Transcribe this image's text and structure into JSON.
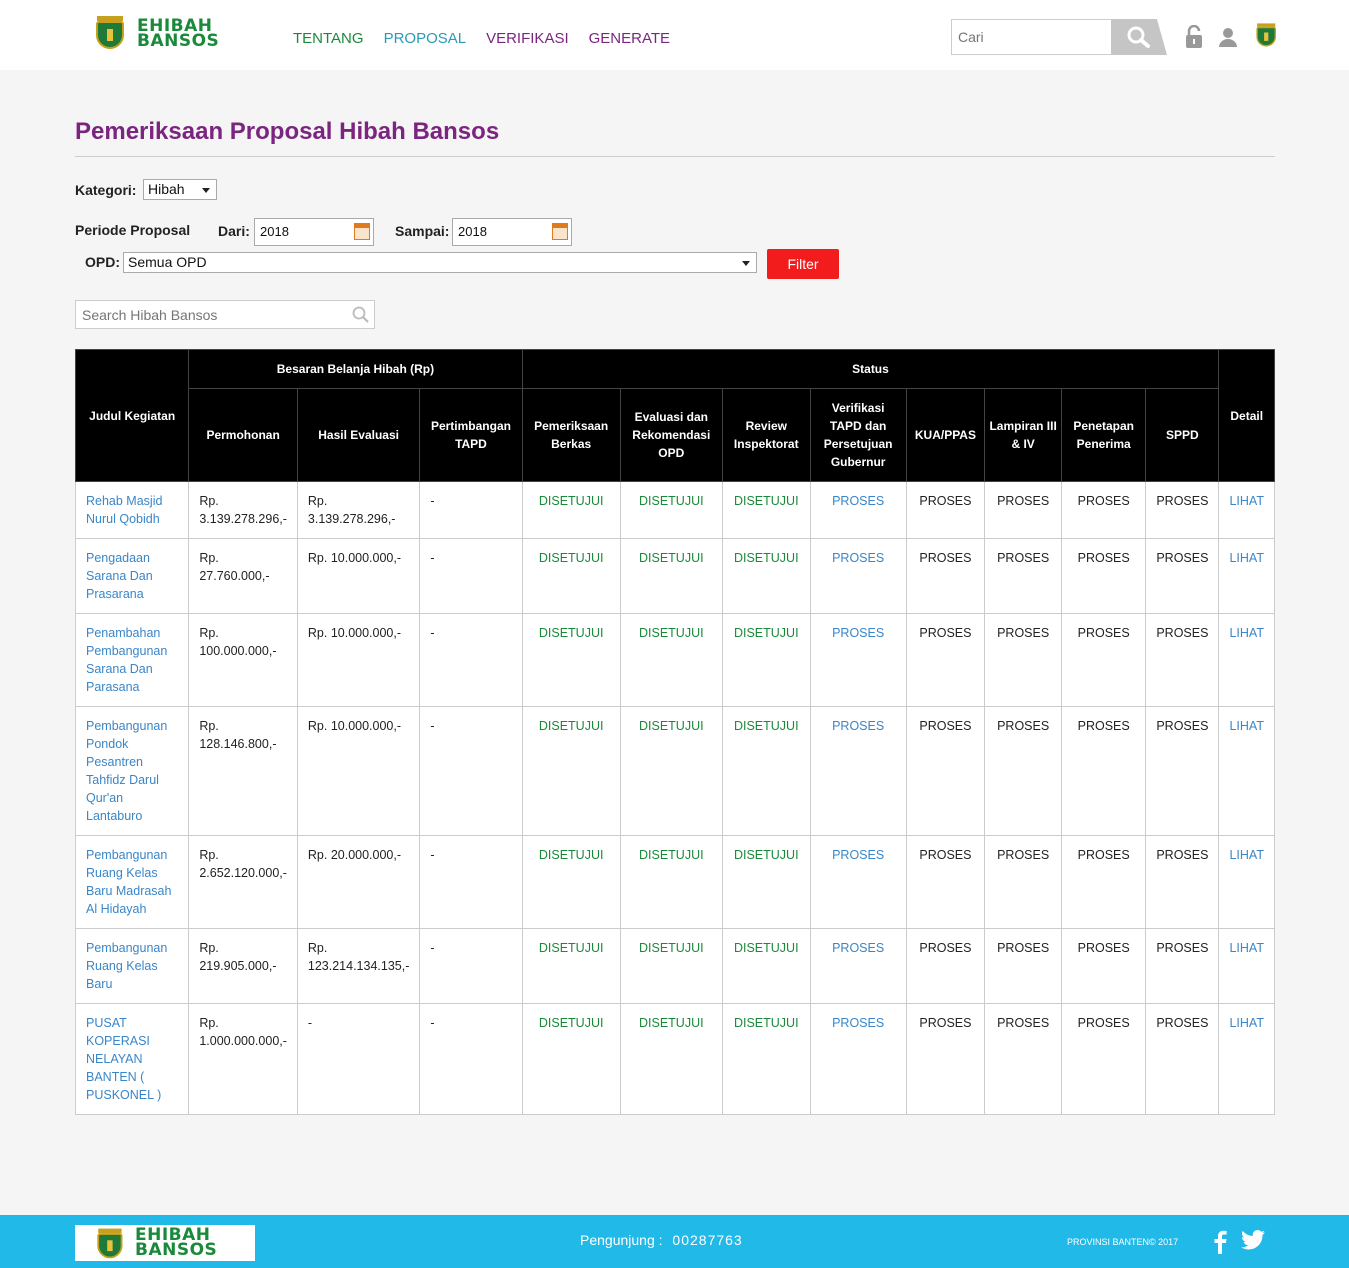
{
  "brand": {
    "line1": "EHIBAH",
    "line2": "BANSOS"
  },
  "nav": [
    "TENTANG",
    "PROPOSAL",
    "VERIFIKASI",
    "GENERATE"
  ],
  "search": {
    "placeholder": "Cari"
  },
  "page": {
    "title": "Pemeriksaan Proposal Hibah Bansos"
  },
  "filters": {
    "kategori_label": "Kategori:",
    "kategori_value": "Hibah",
    "periode_label": "Periode Proposal",
    "dari_label": "Dari:",
    "dari_value": "2018",
    "sampai_label": "Sampai:",
    "sampai_value": "2018",
    "opd_label": "OPD:",
    "opd_value": "Semua OPD",
    "filter_button": "Filter"
  },
  "table_search": {
    "placeholder": "Search Hibah Bansos"
  },
  "table": {
    "headers": {
      "judul": "Judul Kegiatan",
      "besaran": "Besaran Belanja Hibah (Rp)",
      "status": "Status",
      "detail": "Detail",
      "permohonan": "Permohonan",
      "hasil": "Hasil Evaluasi",
      "pertimbangan": "Pertimbangan TAPD",
      "pemeriksaan": "Pemeriksaan Berkas",
      "evaluasi": "Evaluasi dan Rekomendasi OPD",
      "review": "Review Inspektorat",
      "verifikasi": "Verifikasi TAPD dan Persetujuan Gubernur",
      "kua": "KUA/PPAS",
      "lampiran": "Lampiran III & IV",
      "penetapan": "Penetapan Penerima",
      "sppd": "SPPD"
    },
    "rows": [
      {
        "judul": "Rehab Masjid Nurul Qobidh",
        "permohonan": "Rp. 3.139.278.296,-",
        "hasil": "Rp. 3.139.278.296,-",
        "pertimbangan": "-",
        "pemeriksaan": "DISETUJUI",
        "evaluasi": "DISETUJUI",
        "review": "DISETUJUI",
        "verifikasi": "PROSES",
        "kua": "PROSES",
        "lampiran": "PROSES",
        "penetapan": "PROSES",
        "sppd": "PROSES",
        "detail": "LIHAT"
      },
      {
        "judul": "Pengadaan Sarana Dan Prasarana",
        "permohonan": "Rp. 27.760.000,-",
        "hasil": "Rp. 10.000.000,-",
        "pertimbangan": "-",
        "pemeriksaan": "DISETUJUI",
        "evaluasi": "DISETUJUI",
        "review": "DISETUJUI",
        "verifikasi": "PROSES",
        "kua": "PROSES",
        "lampiran": "PROSES",
        "penetapan": "PROSES",
        "sppd": "PROSES",
        "detail": "LIHAT"
      },
      {
        "judul": "Penambahan Pembangunan Sarana Dan Parasana",
        "permohonan": "Rp. 100.000.000,-",
        "hasil": "Rp. 10.000.000,-",
        "pertimbangan": "-",
        "pemeriksaan": "DISETUJUI",
        "evaluasi": "DISETUJUI",
        "review": "DISETUJUI",
        "verifikasi": "PROSES",
        "kua": "PROSES",
        "lampiran": "PROSES",
        "penetapan": "PROSES",
        "sppd": "PROSES",
        "detail": "LIHAT"
      },
      {
        "judul": "Pembangunan Pondok Pesantren Tahfidz Darul Qur'an Lantaburo",
        "permohonan": "Rp. 128.146.800,-",
        "hasil": "Rp. 10.000.000,-",
        "pertimbangan": "-",
        "pemeriksaan": "DISETUJUI",
        "evaluasi": "DISETUJUI",
        "review": "DISETUJUI",
        "verifikasi": "PROSES",
        "kua": "PROSES",
        "lampiran": "PROSES",
        "penetapan": "PROSES",
        "sppd": "PROSES",
        "detail": "LIHAT"
      },
      {
        "judul": "Pembangunan Ruang Kelas Baru Madrasah Al Hidayah",
        "permohonan": "Rp. 2.652.120.000,-",
        "hasil": "Rp. 20.000.000,-",
        "pertimbangan": "-",
        "pemeriksaan": "DISETUJUI",
        "evaluasi": "DISETUJUI",
        "review": "DISETUJUI",
        "verifikasi": "PROSES",
        "kua": "PROSES",
        "lampiran": "PROSES",
        "penetapan": "PROSES",
        "sppd": "PROSES",
        "detail": "LIHAT"
      },
      {
        "judul": "Pembangunan Ruang Kelas Baru",
        "permohonan": "Rp. 219.905.000,-",
        "hasil": "Rp. 123.214.134.135,-",
        "pertimbangan": "-",
        "pemeriksaan": "DISETUJUI",
        "evaluasi": "DISETUJUI",
        "review": "DISETUJUI",
        "verifikasi": "PROSES",
        "kua": "PROSES",
        "lampiran": "PROSES",
        "penetapan": "PROSES",
        "sppd": "PROSES",
        "detail": "LIHAT"
      },
      {
        "judul": "PUSAT KOPERASI NELAYAN BANTEN ( PUSKONEL )",
        "permohonan": "Rp. 1.000.000.000,-",
        "hasil": "-",
        "pertimbangan": "-",
        "pemeriksaan": "DISETUJUI",
        "evaluasi": "DISETUJUI",
        "review": "DISETUJUI",
        "verifikasi": "PROSES",
        "kua": "PROSES",
        "lampiran": "PROSES",
        "penetapan": "PROSES",
        "sppd": "PROSES",
        "detail": "LIHAT"
      }
    ]
  },
  "footer": {
    "visitor_label": "Pengunjung :",
    "visitor_count": "00287763",
    "copyright": "PROVINSI BANTEN© 2017"
  },
  "colors": {
    "accent_purple": "#7b2580",
    "brand_green": "#1a8a3a",
    "footer_blue": "#21b9e8",
    "filter_red": "#f21c1c"
  },
  "icons": [
    "search-icon",
    "lock-icon",
    "user-icon",
    "emblem-icon",
    "calendar-icon",
    "facebook-icon",
    "twitter-icon"
  ]
}
